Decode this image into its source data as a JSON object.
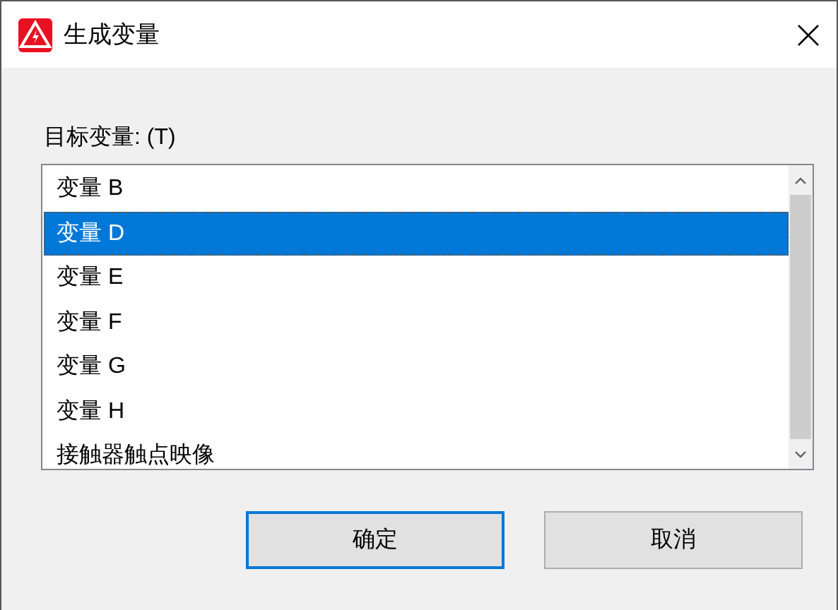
{
  "window": {
    "title": "生成变量"
  },
  "target_label": "目标变量: (T)",
  "items": [
    {
      "label": "变量 B",
      "selected": false
    },
    {
      "label": "变量 D",
      "selected": true
    },
    {
      "label": "变量 E",
      "selected": false
    },
    {
      "label": "变量 F",
      "selected": false
    },
    {
      "label": "变量 G",
      "selected": false
    },
    {
      "label": "变量 H",
      "selected": false
    },
    {
      "label": "接触器触点映像",
      "selected": false
    }
  ],
  "buttons": [
    {
      "label": "确定",
      "default": true
    },
    {
      "label": "取消",
      "default": false
    }
  ]
}
